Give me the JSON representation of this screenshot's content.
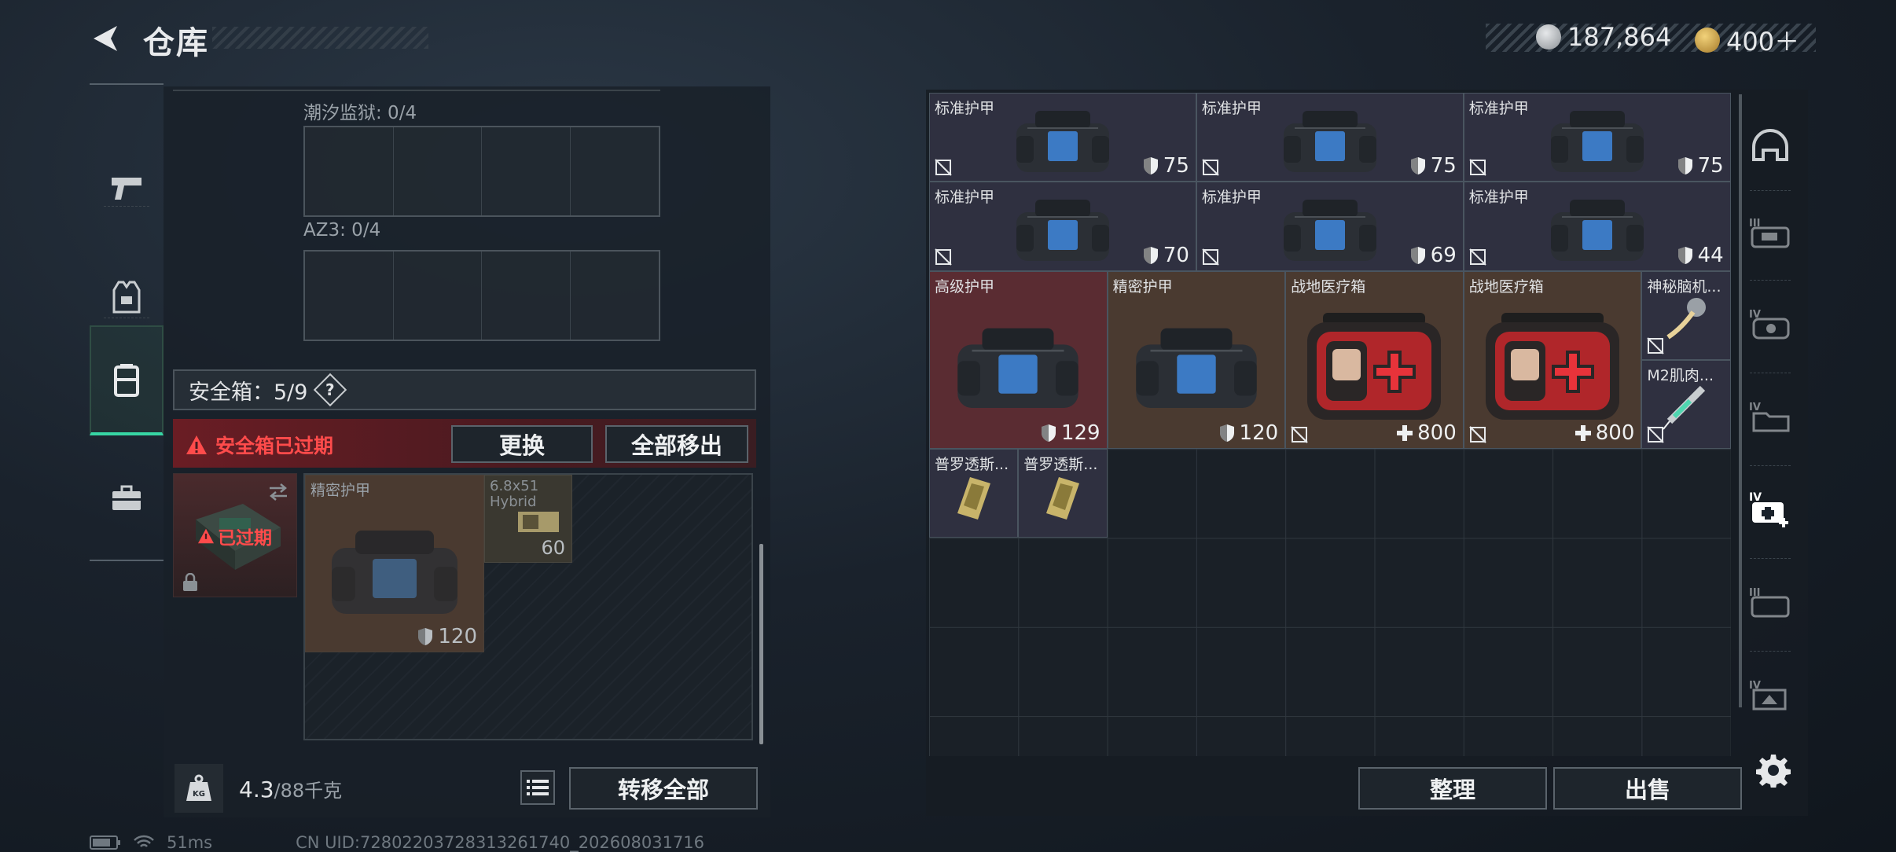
{
  "header": {
    "title": "仓库"
  },
  "currency": {
    "silver": "187,864",
    "gold": "400＋"
  },
  "left_nav": [
    "weapons-icon",
    "armor-icon",
    "container-icon",
    "toolbox-icon"
  ],
  "left_panel": {
    "section1": "潮汐监狱: 0/4",
    "section2": "AZ3: 0/4",
    "safebox_label": "安全箱：5/9",
    "qmark": "?",
    "expired_text": "安全箱已过期",
    "replace_btn": "更换",
    "move_all_btn": "全部移出",
    "case_expired": "已过期",
    "case_item": {
      "name": "精密护甲",
      "value": "120"
    },
    "ammo_item": {
      "name": "6.8x51 Hybrid",
      "count": "60"
    }
  },
  "footer": {
    "weight": "4.3",
    "weight_max": "/88千克",
    "transfer_btn": "转移全部",
    "sort_btn": "整理",
    "sell_btn": "出售"
  },
  "items": [
    {
      "name": "标准护甲",
      "value": "75",
      "kind": "armor"
    },
    {
      "name": "标准护甲",
      "value": "75",
      "kind": "armor"
    },
    {
      "name": "标准护甲",
      "value": "75",
      "kind": "armor"
    },
    {
      "name": "标准护甲",
      "value": "70",
      "kind": "armor"
    },
    {
      "name": "标准护甲",
      "value": "69",
      "kind": "armor"
    },
    {
      "name": "标准护甲",
      "value": "44",
      "kind": "armor"
    },
    {
      "name": "高级护甲",
      "value": "129",
      "kind": "armor"
    },
    {
      "name": "精密护甲",
      "value": "120",
      "kind": "armor"
    },
    {
      "name": "战地医疗箱",
      "value": "800",
      "kind": "med"
    },
    {
      "name": "战地医疗箱",
      "value": "800",
      "kind": "med"
    },
    {
      "name": "神秘脑机...",
      "value": "",
      "kind": "misc"
    },
    {
      "name": "M2肌肉...",
      "value": "",
      "kind": "misc"
    },
    {
      "name": "普罗透斯...",
      "value": "",
      "kind": "misc"
    },
    {
      "name": "普罗透斯...",
      "value": "",
      "kind": "misc"
    }
  ],
  "status": {
    "ping": "51ms",
    "uid": "CN UID:7280220372831326174​0_202608031716"
  }
}
